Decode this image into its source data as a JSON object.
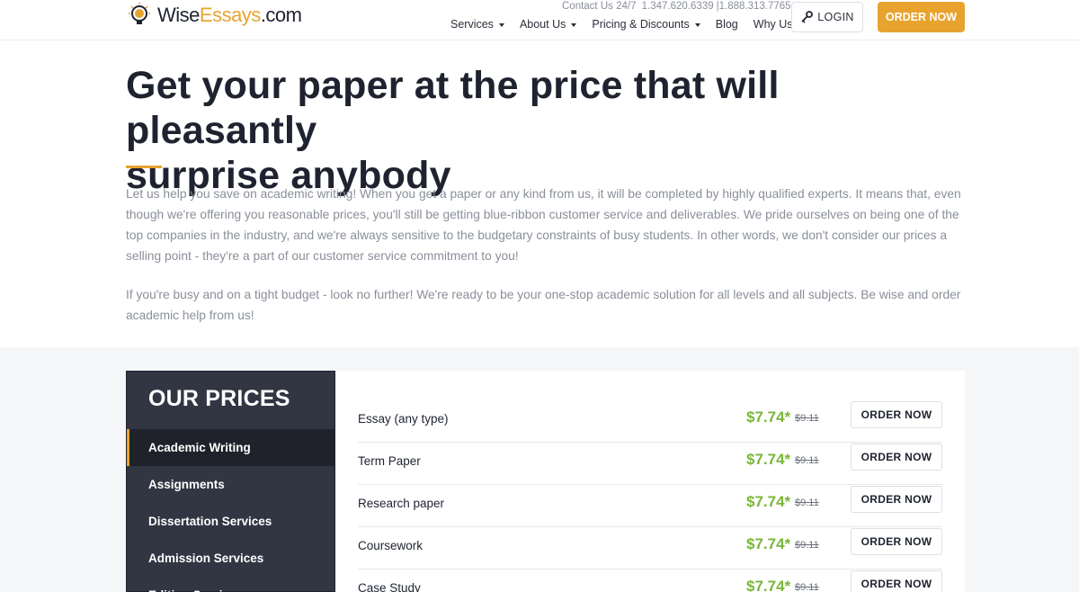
{
  "header": {
    "logo": {
      "part1": "Wise",
      "part2": "Essays",
      "part3": ".com"
    },
    "contact": {
      "label": "Contact Us 24/7",
      "phone1": "1.347.620.6339",
      "phone2": "|1.888.313.7765"
    },
    "nav": [
      {
        "label": "Services",
        "has_dropdown": true
      },
      {
        "label": "About Us",
        "has_dropdown": true
      },
      {
        "label": "Pricing & Discounts",
        "has_dropdown": true
      },
      {
        "label": "Blog",
        "has_dropdown": false
      },
      {
        "label": "Why Us",
        "has_dropdown": false
      }
    ],
    "login_label": "LOGIN",
    "order_label": "ORDER NOW"
  },
  "hero": {
    "title_line1": "Get your paper at the price that will pleasantly",
    "title_line2": "surprise anybody",
    "paragraph1": "Let us help you save on academic writing! When you get a paper or any kind from us, it will be completed by highly qualified experts. It means that, even though we're offering you reasonable prices, you'll still be getting blue-ribbon customer service and deliverables. We pride ourselves on being one of the top companies in the industry, and we're always sensitive to the budgetary constraints of busy students. In other words, we don't consider our prices a selling point - they're a part of our customer service commitment to you!",
    "paragraph2": "If you're busy and on a tight budget - look no further! We're ready to be your one-stop academic solution for all levels and all subjects. Be wise and order academic help from us!"
  },
  "prices": {
    "heading": "OUR PRICES",
    "categories": [
      "Academic Writing",
      "Assignments",
      "Dissertation Services",
      "Admission Services",
      "Editing Services"
    ],
    "rows": [
      {
        "name": "Essay (any type)",
        "price": "$7.74*",
        "old_price": "$9.11",
        "button": "ORDER NOW"
      },
      {
        "name": "Term Paper",
        "price": "$7.74*",
        "old_price": "$9.11",
        "button": "ORDER NOW"
      },
      {
        "name": "Research paper",
        "price": "$7.74*",
        "old_price": "$9.11",
        "button": "ORDER NOW"
      },
      {
        "name": "Coursework",
        "price": "$7.74*",
        "old_price": "$9.11",
        "button": "ORDER NOW"
      },
      {
        "name": "Case Study",
        "price": "$7.74*",
        "old_price": "$9.11",
        "button": "ORDER NOW"
      }
    ]
  },
  "colors": {
    "accent": "#e8a32e",
    "price_green": "#7ab63a",
    "sidebar_bg": "#323643"
  }
}
